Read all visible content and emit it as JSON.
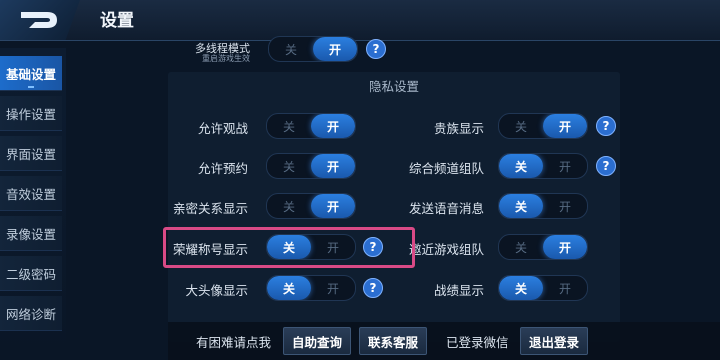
{
  "header": {
    "title": "设置",
    "back_icon": "back-arrow-icon"
  },
  "sidebar": {
    "items": [
      {
        "label": "基础设置",
        "active": true
      },
      {
        "label": "操作设置"
      },
      {
        "label": "界面设置"
      },
      {
        "label": "音效设置"
      },
      {
        "label": "录像设置"
      },
      {
        "label": "二级密码"
      },
      {
        "label": "网络诊断"
      }
    ]
  },
  "top_partial": {
    "label": "多线程模式",
    "sublabel": "重启游戏生效",
    "off": "关",
    "on": "开",
    "selected": "on"
  },
  "privacy": {
    "header": "隐私设置",
    "left": [
      {
        "label": "允许观战",
        "off": "关",
        "on": "开",
        "selected": "on"
      },
      {
        "label": "允许预约",
        "off": "关",
        "on": "开",
        "selected": "on"
      },
      {
        "label": "亲密关系显示",
        "off": "关",
        "on": "开",
        "selected": "on"
      },
      {
        "label": "荣耀称号显示",
        "off": "关",
        "on": "开",
        "selected": "off"
      },
      {
        "label": "大头像显示",
        "off": "关",
        "on": "开",
        "selected": "off"
      }
    ],
    "right": [
      {
        "label": "贵族显示",
        "off": "关",
        "on": "开",
        "selected": "on"
      },
      {
        "label": "综合频道组队",
        "off": "关",
        "on": "开",
        "selected": "off"
      },
      {
        "label": "发送语音消息",
        "off": "关",
        "on": "开",
        "selected": "off"
      },
      {
        "label": "邀近游戏组队",
        "off": "关",
        "on": "开",
        "selected": "on"
      },
      {
        "label": "战绩显示",
        "off": "关",
        "on": "开",
        "selected": "off"
      }
    ]
  },
  "help_symbol": "?",
  "bottom": {
    "help_text": "有困难请点我",
    "self_help": "自助查询",
    "contact": "联系客服",
    "login_text": "已登录微信",
    "logout": "退出登录"
  },
  "colors": {
    "accent": "#1d6ccb",
    "highlight": "#d94a86",
    "background": "#0a1626"
  }
}
